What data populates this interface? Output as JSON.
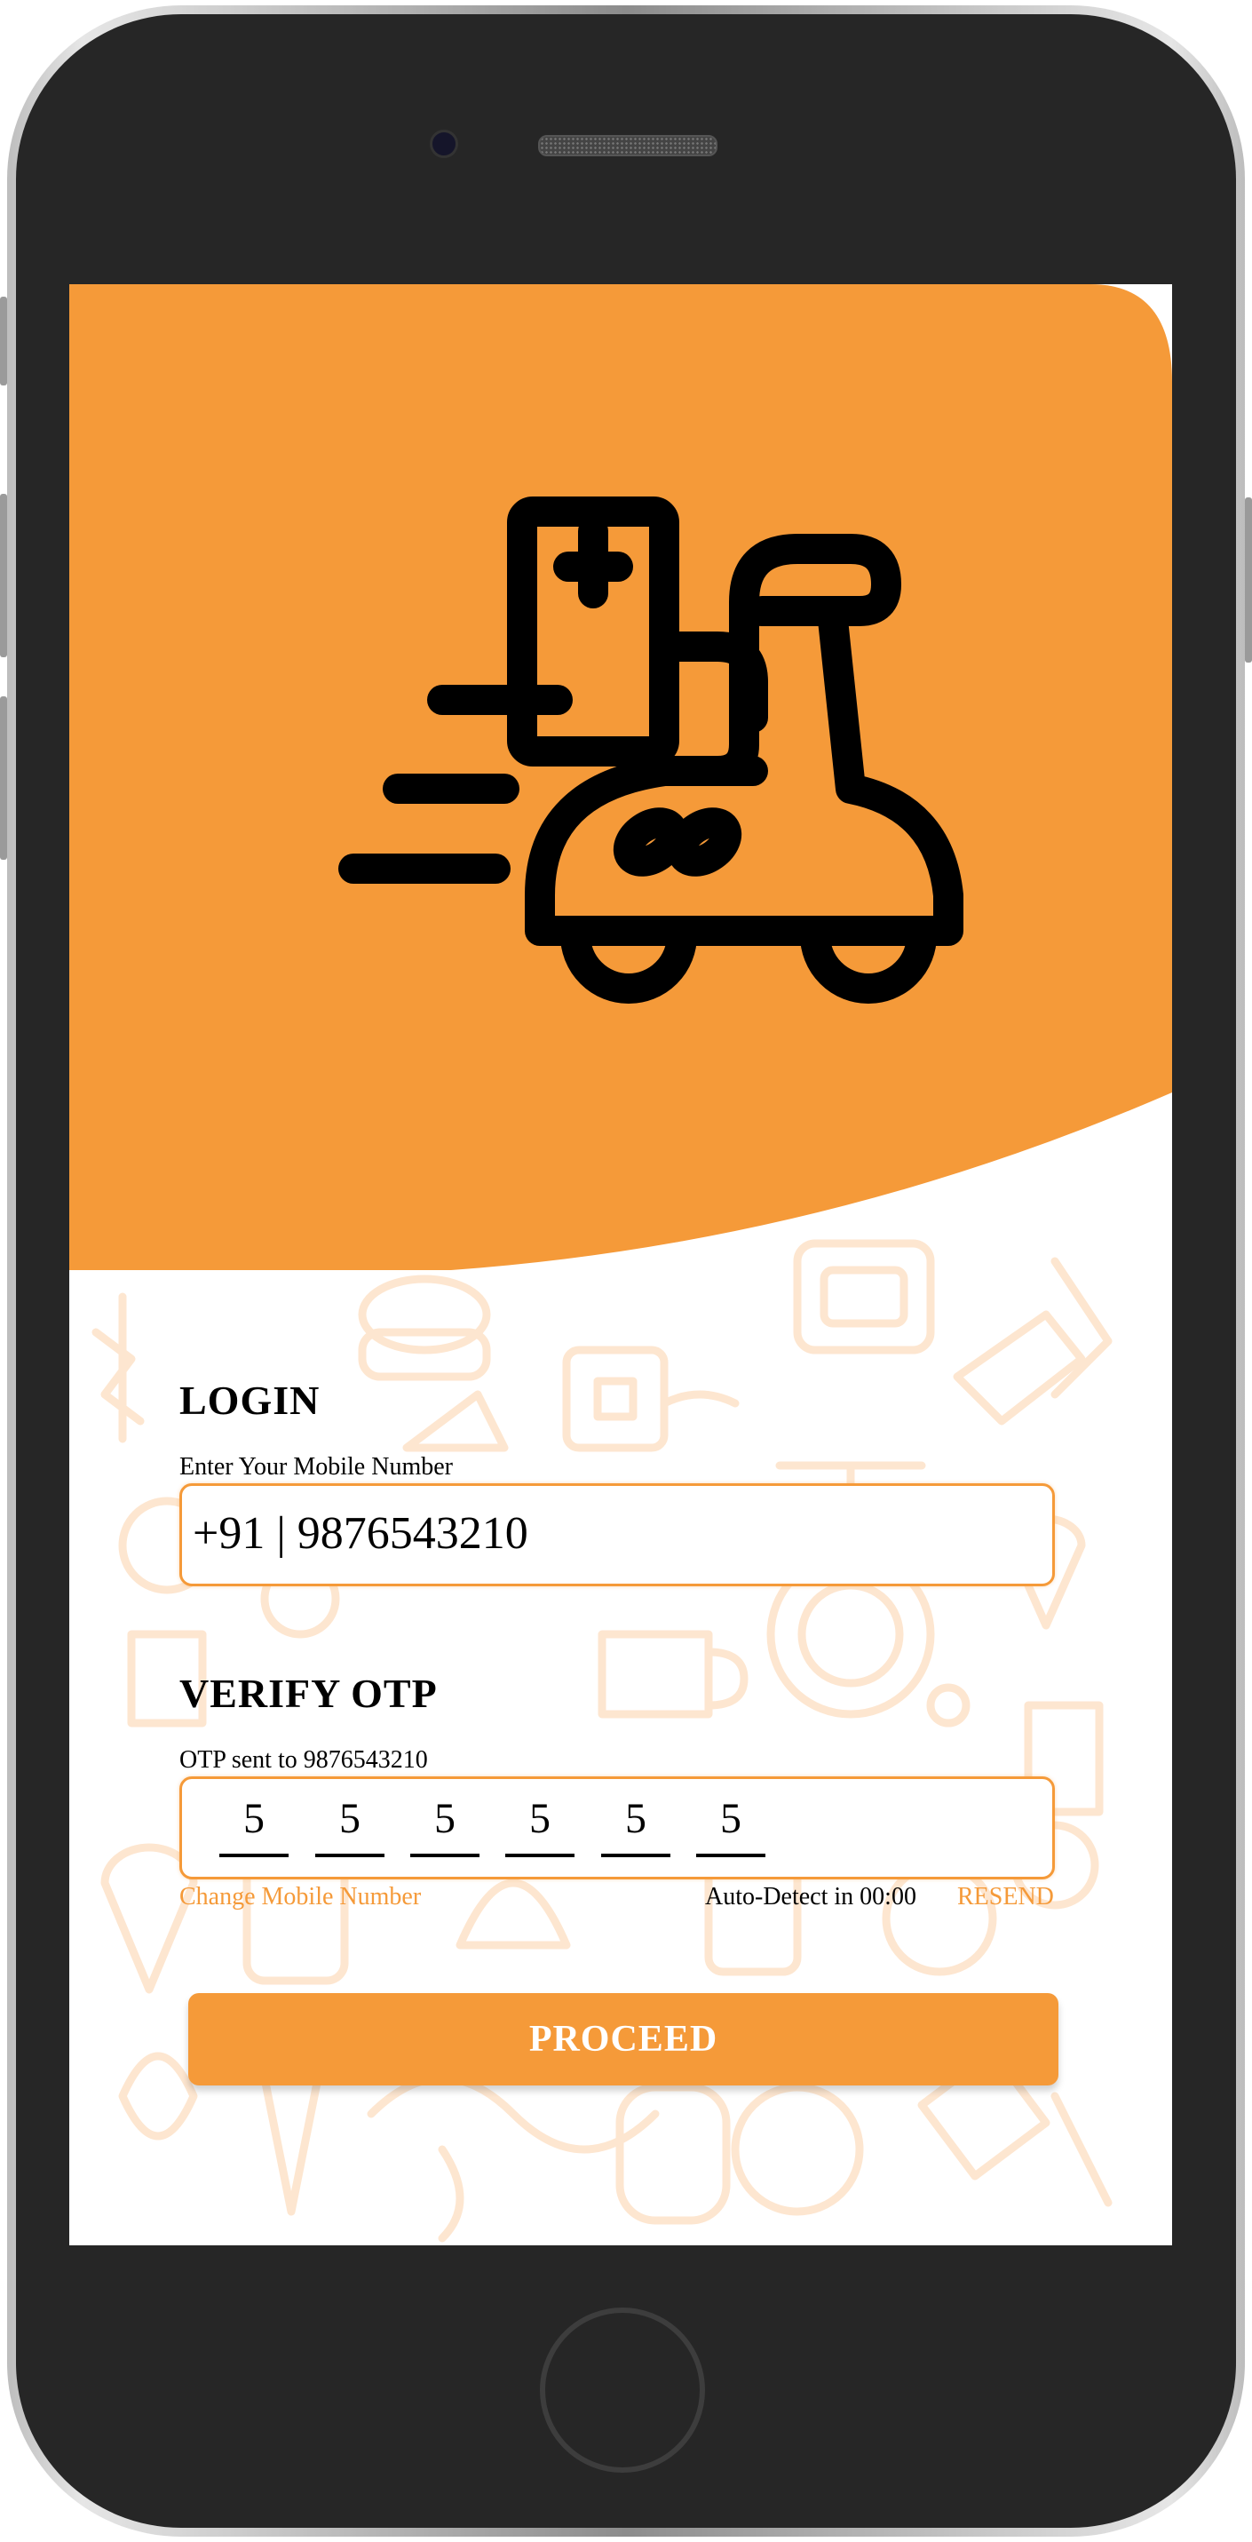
{
  "colors": {
    "accent": "#f59a39",
    "doodle": "#fde6d0",
    "text": "#000000"
  },
  "login": {
    "title": "LOGIN",
    "label": "Enter Your Mobile Number",
    "phone_value": "+91 | 9876543210"
  },
  "verify": {
    "title": "VERIFY OTP",
    "sent_label": "OTP sent to 9876543210",
    "otp_digits": [
      "5",
      "5",
      "5",
      "5",
      "5",
      "5"
    ],
    "change_number": "Change Mobile Number",
    "auto_detect": "Auto-Detect in 00:00",
    "resend": "RESEND"
  },
  "proceed_label": "PROCEED",
  "icons": {
    "hero": "delivery-scooter-icon",
    "background": "food-doodle-pattern"
  }
}
